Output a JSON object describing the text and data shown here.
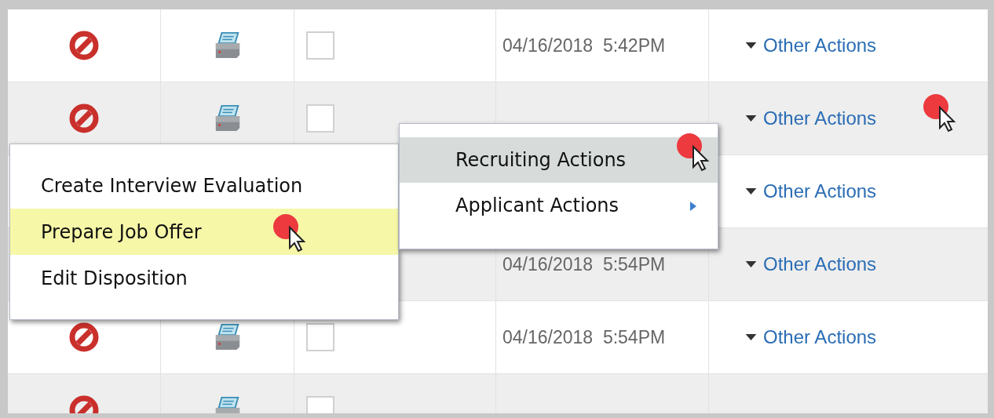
{
  "rows": [
    {
      "checkbox": {
        "checked": false
      },
      "datetime": "04/16/2018  5:42PM",
      "action": "Other Actions",
      "selected": false
    },
    {
      "checkbox": {
        "checked": false
      },
      "action": "Other Actions",
      "selected": true
    },
    {
      "action": "Other Actions",
      "selected": false
    },
    {
      "datetime": "04/16/2018  5:54PM",
      "action": "Other Actions",
      "selected": false
    },
    {
      "checkbox": {
        "checked": false
      },
      "datetime": "04/16/2018  5:54PM",
      "action": "Other Actions",
      "selected": false
    },
    {
      "checkbox": {
        "checked": false
      }
    }
  ],
  "context_menu": {
    "items": [
      {
        "label": "Create Interview Evaluation",
        "selected": false
      },
      {
        "label": "Prepare Job Offer",
        "selected": true
      },
      {
        "label": "Edit Disposition",
        "selected": false
      }
    ]
  },
  "submenu": {
    "items": [
      {
        "label": "Recruiting Actions",
        "selected": true,
        "has_submenu": false
      },
      {
        "label": "Applicant Actions",
        "selected": false,
        "has_submenu": true
      }
    ]
  }
}
